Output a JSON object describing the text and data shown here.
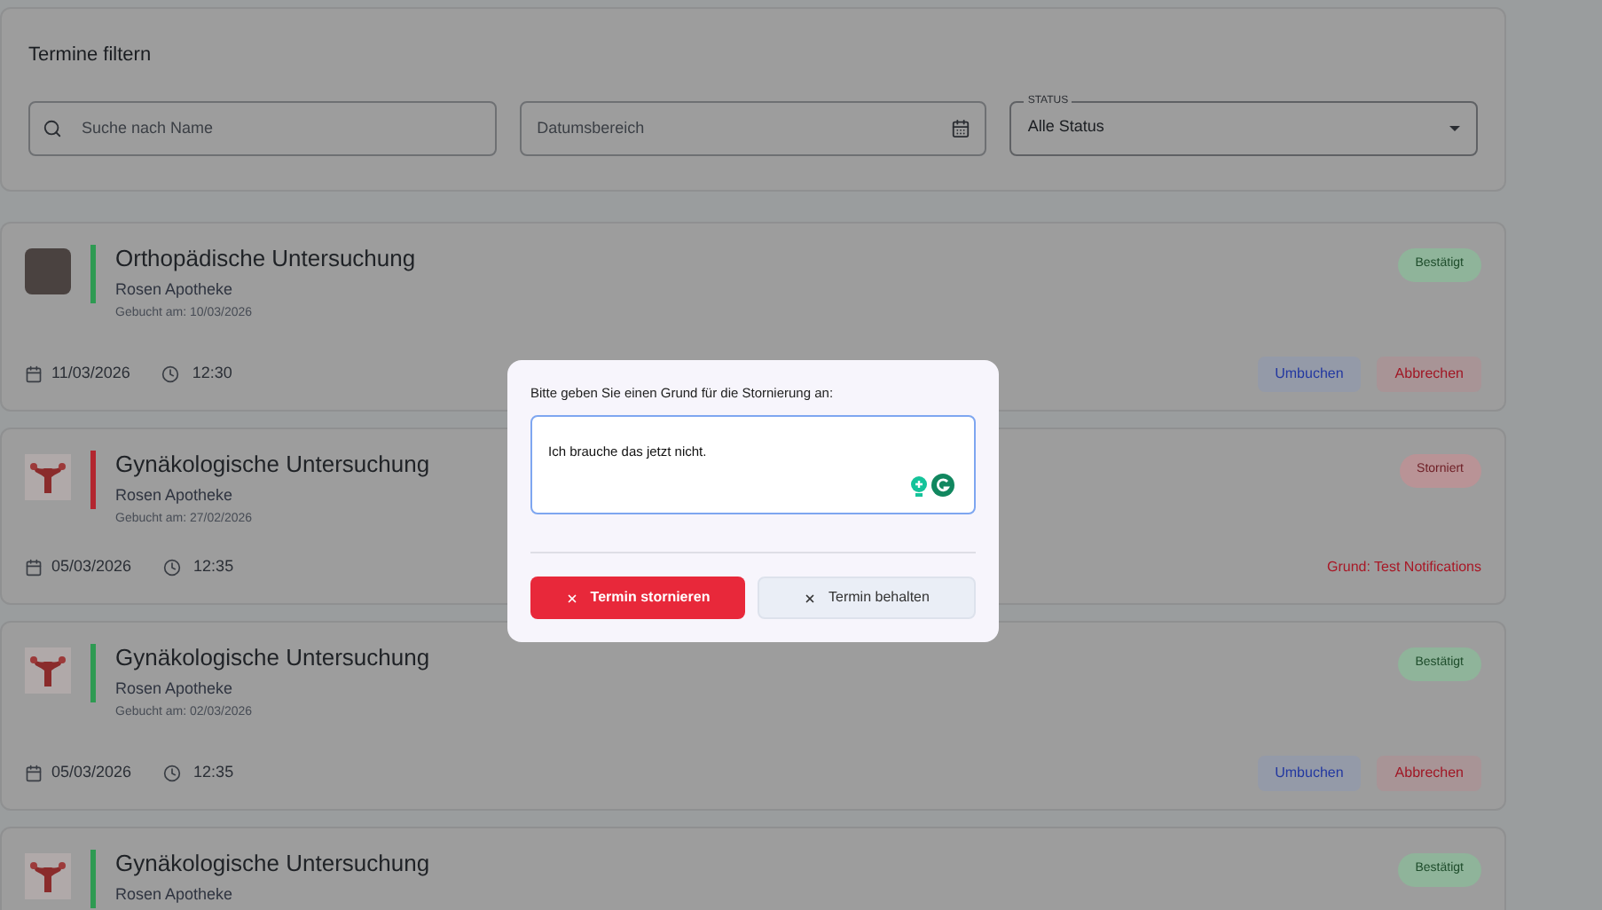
{
  "filter": {
    "title": "Termine filtern",
    "search": {
      "placeholder": "Suche nach Name"
    },
    "date_range": {
      "placeholder": "Datumsbereich"
    },
    "status": {
      "label": "STATUS",
      "value": "Alle Status"
    }
  },
  "appointments": [
    {
      "thumbnail": {
        "kind": "photo"
      },
      "title": "Orthopädische Untersuchung",
      "provider": "Rosen Apotheke",
      "booked": "Gebucht am: 10/03/2026",
      "date": "11/03/2026",
      "time": "12:30",
      "status": {
        "label": "Bestätigt",
        "kind": "confirmed"
      },
      "actions": [
        {
          "label": "Umbuchen",
          "kind": "reschedule"
        },
        {
          "label": "Abbrechen",
          "kind": "cancel"
        }
      ]
    },
    {
      "thumbnail": {
        "kind": "drawing"
      },
      "title": "Gynäkologische Untersuchung",
      "provider": "Rosen Apotheke",
      "booked": "Gebucht am: 27/02/2026",
      "date": "05/03/2026",
      "time": "12:35",
      "status": {
        "label": "Storniert",
        "kind": "cancelled"
      },
      "reason": "Grund: Test Notifications"
    },
    {
      "thumbnail": {
        "kind": "drawing"
      },
      "title": "Gynäkologische Untersuchung",
      "provider": "Rosen Apotheke",
      "booked": "Gebucht am: 02/03/2026",
      "date": "05/03/2026",
      "time": "12:35",
      "status": {
        "label": "Bestätigt",
        "kind": "confirmed"
      },
      "actions": [
        {
          "label": "Umbuchen",
          "kind": "reschedule"
        },
        {
          "label": "Abbrechen",
          "kind": "cancel"
        }
      ]
    },
    {
      "thumbnail": {
        "kind": "drawing"
      },
      "title": "Gynäkologische Untersuchung",
      "provider": "Rosen Apotheke",
      "status": {
        "label": "Bestätigt",
        "kind": "confirmed"
      }
    }
  ],
  "dialog": {
    "prompt": "Bitte geben Sie einen Grund für die Stornierung an:",
    "reason": {
      "value": "Ich brauche das jetzt nicht."
    },
    "buttons": [
      {
        "label": "Termin stornieren",
        "kind": "confirm"
      },
      {
        "label": "Termin behalten",
        "kind": "dismiss"
      }
    ]
  }
}
